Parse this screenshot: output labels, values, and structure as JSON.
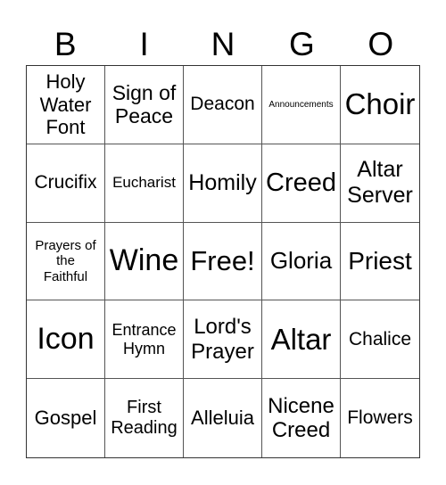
{
  "header": {
    "letters": [
      "B",
      "I",
      "N",
      "G",
      "O"
    ]
  },
  "cells": [
    {
      "text": "Holy Water Font",
      "lines": [
        "Holy",
        "Water",
        "Font"
      ]
    },
    {
      "text": "Sign of Peace",
      "lines": [
        "Sign of",
        "Peace"
      ]
    },
    {
      "text": "Deacon",
      "lines": [
        "Deacon"
      ]
    },
    {
      "text": "Announcements",
      "lines": [
        "Announcements"
      ]
    },
    {
      "text": "Choir",
      "lines": [
        "Choir"
      ]
    },
    {
      "text": "Crucifix",
      "lines": [
        "Crucifix"
      ]
    },
    {
      "text": "Eucharist",
      "lines": [
        "Eucharist"
      ]
    },
    {
      "text": "Homily",
      "lines": [
        "Homily"
      ]
    },
    {
      "text": "Creed",
      "lines": [
        "Creed"
      ]
    },
    {
      "text": "Altar Server",
      "lines": [
        "Altar",
        "Server"
      ]
    },
    {
      "text": "Prayers of the Faithful",
      "lines": [
        "Prayers of",
        "the",
        "Faithful"
      ]
    },
    {
      "text": "Wine",
      "lines": [
        "Wine"
      ]
    },
    {
      "text": "Free!",
      "lines": [
        "Free!"
      ]
    },
    {
      "text": "Gloria",
      "lines": [
        "Gloria"
      ]
    },
    {
      "text": "Priest",
      "lines": [
        "Priest"
      ]
    },
    {
      "text": "Icon",
      "lines": [
        "Icon"
      ]
    },
    {
      "text": "Entrance Hymn",
      "lines": [
        "Entrance",
        "Hymn"
      ]
    },
    {
      "text": "Lord's Prayer",
      "lines": [
        "Lord's",
        "Prayer"
      ]
    },
    {
      "text": "Altar",
      "lines": [
        "Altar"
      ]
    },
    {
      "text": "Chalice",
      "lines": [
        "Chalice"
      ]
    },
    {
      "text": "Gospel",
      "lines": [
        "Gospel"
      ]
    },
    {
      "text": "First Reading",
      "lines": [
        "First",
        "Reading"
      ]
    },
    {
      "text": "Alleluia",
      "lines": [
        "Alleluia"
      ]
    },
    {
      "text": "Nicene Creed",
      "lines": [
        "Nicene",
        "Creed"
      ]
    },
    {
      "text": "Flowers",
      "lines": [
        "Flowers"
      ]
    }
  ]
}
